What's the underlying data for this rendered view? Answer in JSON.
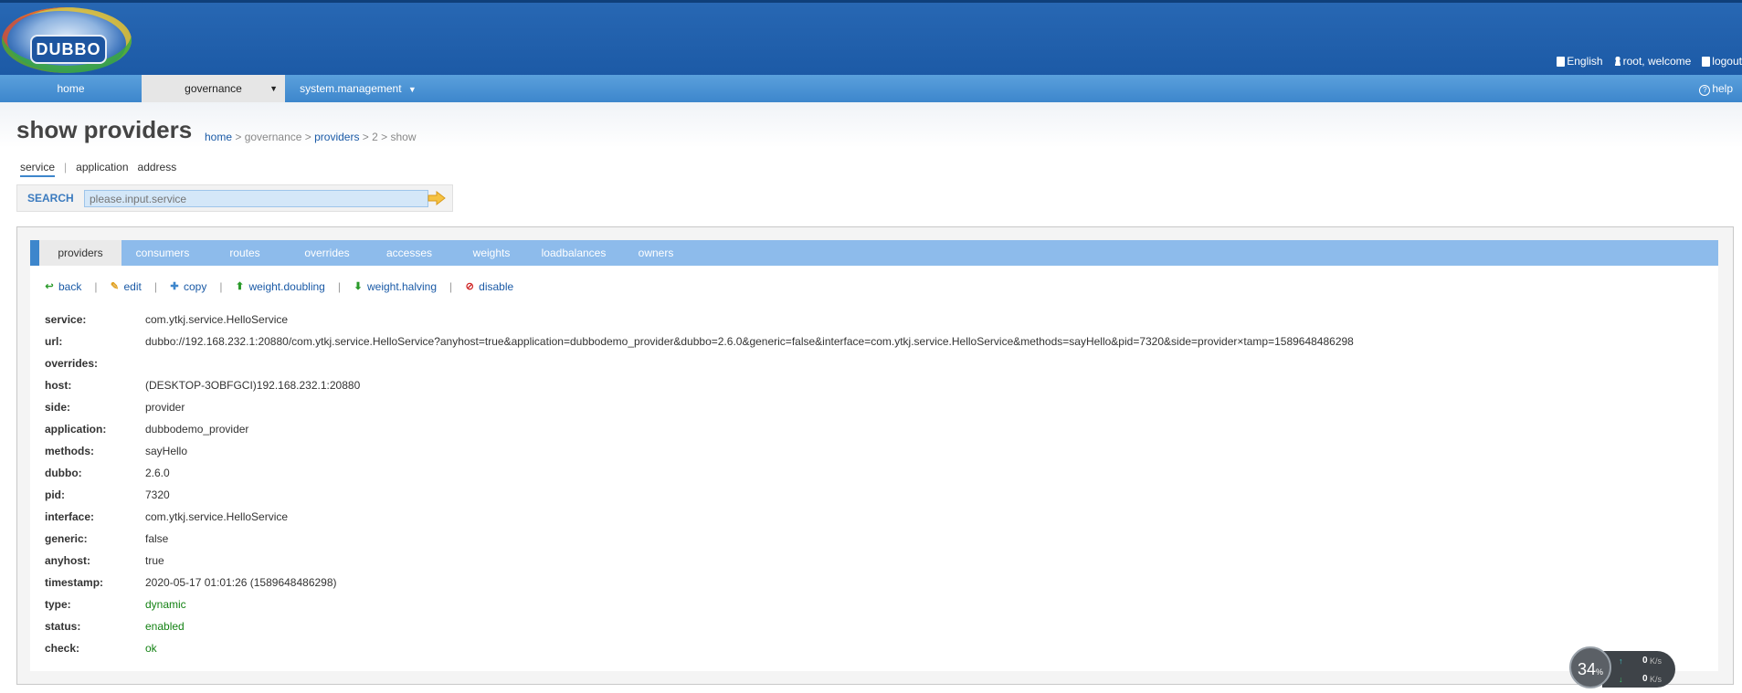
{
  "app": {
    "logo_text": "DUBBO"
  },
  "user": {
    "language": "English",
    "welcome": "root, welcome",
    "logout": "logout"
  },
  "nav": {
    "items": [
      {
        "label": "home"
      },
      {
        "label": "governance"
      },
      {
        "label": "system.management"
      }
    ],
    "help": "help"
  },
  "page": {
    "title": "show providers",
    "breadcrumb": {
      "home": "home",
      "sep1": " > governance > ",
      "providers": "providers",
      "rest": " > 2 > show"
    }
  },
  "search": {
    "tabs": [
      "service",
      "application",
      "address"
    ],
    "label": "SEARCH",
    "placeholder": "please.input.service"
  },
  "tabs": [
    "providers",
    "consumers",
    "routes",
    "overrides",
    "accesses",
    "weights",
    "loadbalances",
    "owners"
  ],
  "actions": [
    "back",
    "edit",
    "copy",
    "weight.doubling",
    "weight.halving",
    "disable"
  ],
  "details": [
    {
      "key": "service:",
      "value": "com.ytkj.service.HelloService"
    },
    {
      "key": "url:",
      "value": "dubbo://192.168.232.1:20880/com.ytkj.service.HelloService?anyhost=true&application=dubbodemo_provider&dubbo=2.6.0&generic=false&interface=com.ytkj.service.HelloService&methods=sayHello&pid=7320&side=provider×tamp=1589648486298"
    },
    {
      "key": "overrides:",
      "value": ""
    },
    {
      "key": "host:",
      "value": "(DESKTOP-3OBFGCI)192.168.232.1:20880"
    },
    {
      "key": "side:",
      "value": "provider"
    },
    {
      "key": "application:",
      "value": "dubbodemo_provider"
    },
    {
      "key": "methods:",
      "value": "sayHello"
    },
    {
      "key": "dubbo:",
      "value": "2.6.0"
    },
    {
      "key": "pid:",
      "value": "7320"
    },
    {
      "key": "interface:",
      "value": "com.ytkj.service.HelloService"
    },
    {
      "key": "generic:",
      "value": "false"
    },
    {
      "key": "anyhost:",
      "value": "true"
    },
    {
      "key": "timestamp:",
      "value": "2020-05-17 01:01:26 (1589648486298)"
    },
    {
      "key": "type:",
      "value": "dynamic"
    },
    {
      "key": "status:",
      "value": "enabled"
    },
    {
      "key": "check:",
      "value": "ok"
    }
  ],
  "status_colors": {
    "ok_green": "#148214"
  },
  "net_widget": {
    "percent": "34",
    "percent_sign": "%",
    "up": "0",
    "down": "0",
    "unit": "K/s"
  }
}
